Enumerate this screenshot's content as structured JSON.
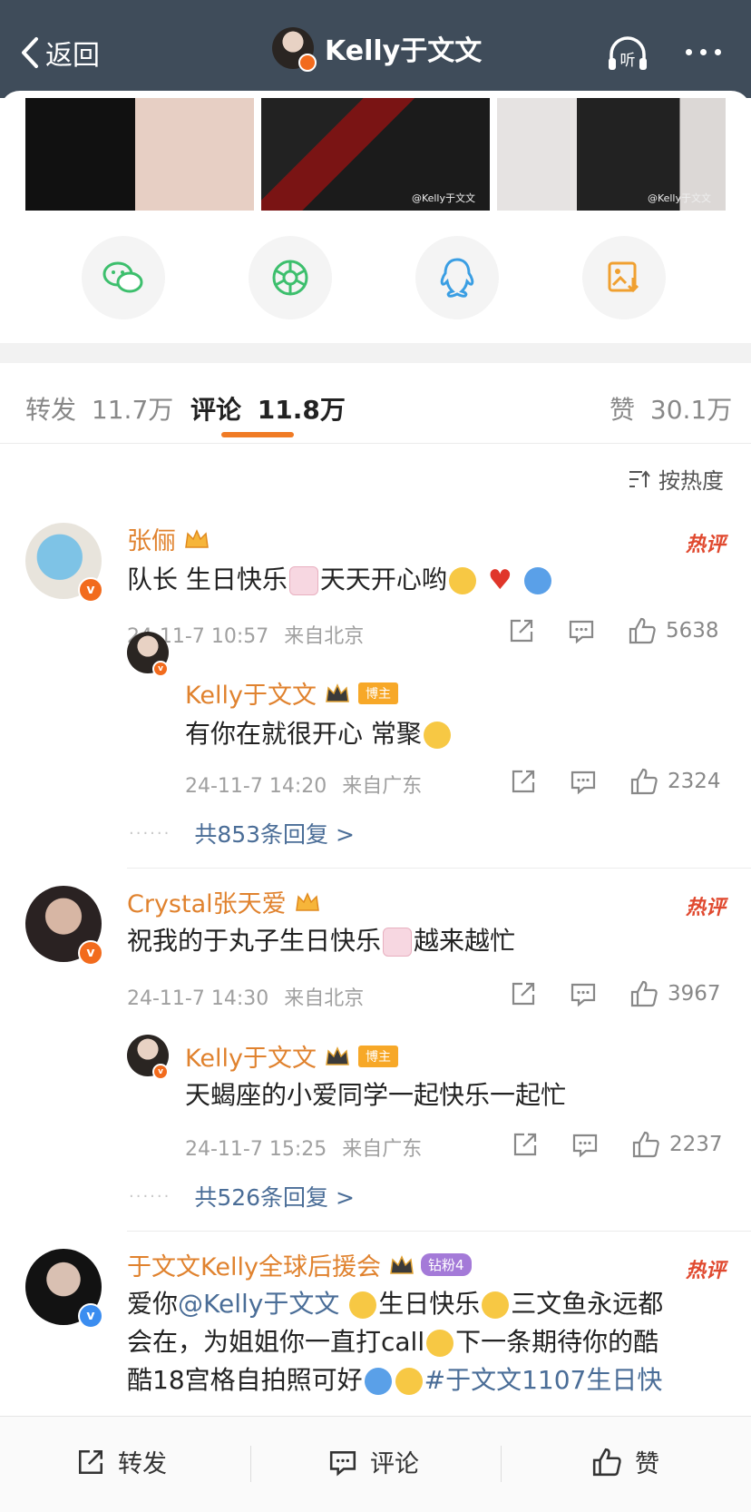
{
  "header": {
    "back_label": "返回",
    "title": "Kelly于文文",
    "listen_label": "听"
  },
  "photos": {
    "watermark": "@Kelly于文文"
  },
  "tabs": {
    "repost": {
      "label": "转发",
      "count": "11.7万"
    },
    "comment": {
      "label": "评论",
      "count": "11.8万"
    },
    "like": {
      "label": "赞",
      "count": "30.1万"
    }
  },
  "sort_label": "按热度",
  "comments": [
    {
      "name": "张俪",
      "hot": "热评",
      "text_a": "队长 生日快乐",
      "text_b": "天天开心哟",
      "time": "24-11-7 10:57",
      "location": "来自北京",
      "likes": "5638",
      "reply": {
        "name": "Kelly于文文",
        "badge": "博主",
        "text": "有你在就很开心 常聚",
        "time": "24-11-7 14:20",
        "location": "来自广东",
        "likes": "2324"
      },
      "more_replies": "共853条回复 >"
    },
    {
      "name": "Crystal张天爱",
      "hot": "热评",
      "text_a": "祝我的于丸子生日快乐",
      "text_b": "越来越忙",
      "time": "24-11-7 14:30",
      "location": "来自北京",
      "likes": "3967",
      "reply": {
        "name": "Kelly于文文",
        "badge": "博主",
        "text": "天蝎座的小爱同学一起快乐一起忙",
        "time": "24-11-7 15:25",
        "location": "来自广东",
        "likes": "2237"
      },
      "more_replies": "共526条回复 >"
    },
    {
      "name": "于文文Kelly全球后援会",
      "badge": "钻粉4",
      "hot": "热评",
      "line1_a": "爱你",
      "line1_mention": "@Kelly于文文",
      "line1_b": "生日快乐",
      "line1_c": "三文鱼永远都",
      "line2_a": "会在，为姐姐你一直打call",
      "line2_b": "下一条期待你的酷",
      "line3_a": "酷18宫格自拍照可好",
      "line3_tag": "#于文文1107生日快"
    }
  ],
  "bottom": {
    "repost": "转发",
    "comment": "评论",
    "like": "赞"
  },
  "colors": {
    "header_bg": "#3f4c5a",
    "accent": "#f07b25",
    "username": "#e0822e",
    "link": "#4a6d97"
  }
}
